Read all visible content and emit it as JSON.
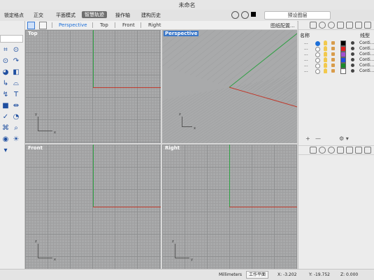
{
  "window": {
    "title": "未命名"
  },
  "command_bar": {
    "items": [
      "锁定格点",
      "正交",
      "平面模式",
      "智慧轨迹",
      "操作轴",
      "建构历史"
    ],
    "active_index": 3,
    "preset_label": "预设图层"
  },
  "viewport_tabs": {
    "tabs": [
      "Perspective",
      "Top",
      "Front",
      "Right"
    ],
    "selected_index": 0,
    "layout_button": "图纸配置..."
  },
  "viewports": {
    "top": {
      "label": "Top",
      "axis_labels": {
        "x": "x",
        "y": "y"
      }
    },
    "perspective": {
      "label": "Perspective",
      "axis_labels": {
        "x": "x",
        "y": "y",
        "z": "z"
      }
    },
    "front": {
      "label": "Front",
      "axis_labels": {
        "x": "x",
        "y": "z"
      }
    },
    "right": {
      "label": "Right",
      "axis_labels": {
        "x": "y",
        "y": "z"
      }
    }
  },
  "layers_panel": {
    "headers": {
      "name": "名称",
      "linetype": "线型"
    },
    "rows": [
      {
        "name": "...",
        "current": true,
        "color": "#000000",
        "linetype": "Conti..."
      },
      {
        "name": "...",
        "current": false,
        "color": "#e02020",
        "linetype": "Conti..."
      },
      {
        "name": "...",
        "current": false,
        "color": "#a050d0",
        "linetype": "Conti..."
      },
      {
        "name": "...",
        "current": false,
        "color": "#1f4ce0",
        "linetype": "Conti..."
      },
      {
        "name": "...",
        "current": false,
        "color": "#1a8a2a",
        "linetype": "Conti..."
      },
      {
        "name": "...",
        "current": false,
        "color": "#ffffff",
        "linetype": "Conti..."
      }
    ],
    "buttons": [
      "+",
      "—",
      "⚙ ▾"
    ]
  },
  "status": {
    "units": "Millimeters",
    "cplane": "工作平面",
    "x": "X: -3.202",
    "y": "Y: -19.752",
    "z": "Z: 0.000"
  },
  "colors": {
    "accent": "#1d6fd8",
    "x_axis": "#c0392b",
    "y_axis": "#2ea043",
    "viewport_bg": "#a9aaab"
  }
}
